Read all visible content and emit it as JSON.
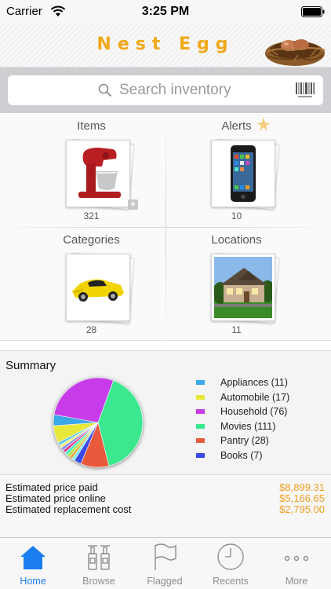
{
  "status_bar": {
    "carrier": "Carrier",
    "time": "3:25 PM"
  },
  "header": {
    "title": "Nest Egg"
  },
  "search": {
    "placeholder": "Search inventory"
  },
  "grid": [
    {
      "title": "Items",
      "count": "321",
      "icon": "mixer-photo"
    },
    {
      "title": "Alerts",
      "count": "10",
      "icon": "phone-photo"
    },
    {
      "title": "Categories",
      "count": "28",
      "icon": "car-photo"
    },
    {
      "title": "Locations",
      "count": "11",
      "icon": "house-photo"
    }
  ],
  "summary": {
    "title": "Summary",
    "legend": [
      {
        "label": "Appliances (11)",
        "color": "#3aa8e8"
      },
      {
        "label": "Automobile (17)",
        "color": "#e8e83a"
      },
      {
        "label": "Household (76)",
        "color": "#c83ae8"
      },
      {
        "label": "Movies (111)",
        "color": "#3ae890"
      },
      {
        "label": "Pantry (28)",
        "color": "#e85a3a"
      },
      {
        "label": "Books (7)",
        "color": "#3a4ae8"
      }
    ]
  },
  "totals": [
    {
      "label": "Estimated price paid",
      "value": "$8,899.31"
    },
    {
      "label": "Estimated price online",
      "value": "$5,166.65"
    },
    {
      "label": "Estimated replacement cost",
      "value": "$2,795.00"
    }
  ],
  "tabs": [
    {
      "label": "Home",
      "active": true,
      "icon": "house-icon"
    },
    {
      "label": "Browse",
      "active": false,
      "icon": "bottles-icon"
    },
    {
      "label": "Flagged",
      "active": false,
      "icon": "flag-icon"
    },
    {
      "label": "Recents",
      "active": false,
      "icon": "clock-icon"
    },
    {
      "label": "More",
      "active": false,
      "icon": "more-icon"
    }
  ],
  "colors": {
    "accent": "#1a7ef0",
    "title": "#f0a818",
    "money": "#f0a020"
  }
}
